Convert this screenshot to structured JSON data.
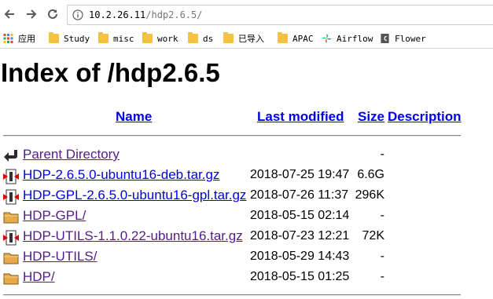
{
  "browser": {
    "url_host": "10.2.26.11",
    "url_path": "/hdp2.6.5/",
    "bookmarks": [
      {
        "label": "应用",
        "icon": "apps-grid-icon"
      },
      {
        "label": "Study",
        "icon": "folder-icon"
      },
      {
        "label": "misc",
        "icon": "folder-icon"
      },
      {
        "label": "work",
        "icon": "folder-icon"
      },
      {
        "label": "ds",
        "icon": "folder-icon"
      },
      {
        "label": "已导入",
        "icon": "folder-icon"
      },
      {
        "label": "APAC",
        "icon": "folder-icon"
      },
      {
        "label": "Airflow",
        "icon": "airflow-icon"
      },
      {
        "label": "Flower",
        "icon": "flower-c-icon"
      }
    ]
  },
  "page": {
    "title": "Index of /hdp2.6.5",
    "headers": {
      "name": "Name",
      "last_modified": "Last modified",
      "size": "Size",
      "description": "Description"
    },
    "rows": [
      {
        "name": "Parent Directory",
        "modified": "",
        "size": "-",
        "icon": "back-arrow-icon",
        "visited": true
      },
      {
        "name": "HDP-2.6.5.0-ubuntu16-deb.tar.gz",
        "modified": "2018-07-25 19:47",
        "size": "6.6G",
        "icon": "archive-icon",
        "visited": false
      },
      {
        "name": "HDP-GPL-2.6.5.0-ubuntu16-gpl.tar.gz",
        "modified": "2018-07-26 11:37",
        "size": "296K",
        "icon": "archive-icon",
        "visited": false
      },
      {
        "name": "HDP-GPL/",
        "modified": "2018-05-15 02:14",
        "size": "-",
        "icon": "folder-icon",
        "visited": true
      },
      {
        "name": "HDP-UTILS-1.1.0.22-ubuntu16.tar.gz",
        "modified": "2018-07-23 12:21",
        "size": "72K",
        "icon": "archive-icon",
        "visited": true
      },
      {
        "name": "HDP-UTILS/",
        "modified": "2018-05-29 14:43",
        "size": "-",
        "icon": "folder-icon",
        "visited": true
      },
      {
        "name": "HDP/",
        "modified": "2018-05-15 01:25",
        "size": "-",
        "icon": "folder-icon",
        "visited": true
      }
    ]
  }
}
